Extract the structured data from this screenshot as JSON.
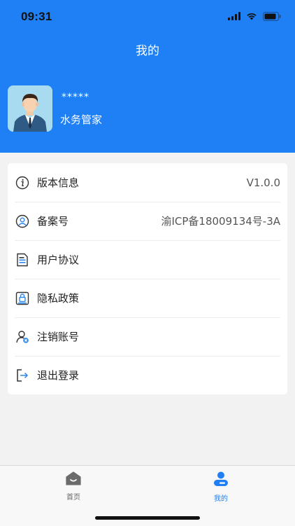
{
  "status": {
    "time": "09:31"
  },
  "header": {
    "title": "我的"
  },
  "profile": {
    "username": "*****",
    "role": "水务管家"
  },
  "menu": [
    {
      "label": "版本信息",
      "value": "V1.0.0",
      "icon": "info-icon"
    },
    {
      "label": "备案号",
      "value": "渝ICP备18009134号-3A",
      "icon": "user-circle-icon"
    },
    {
      "label": "用户协议",
      "value": "",
      "icon": "document-icon"
    },
    {
      "label": "隐私政策",
      "value": "",
      "icon": "privacy-lock-icon"
    },
    {
      "label": "注销账号",
      "value": "",
      "icon": "user-remove-icon"
    },
    {
      "label": "退出登录",
      "value": "",
      "icon": "logout-icon"
    }
  ],
  "tabbar": {
    "home_label": "首页",
    "mine_label": "我的"
  },
  "colors": {
    "brand": "#1f7ff5",
    "icon_blue": "#2b87f0"
  }
}
